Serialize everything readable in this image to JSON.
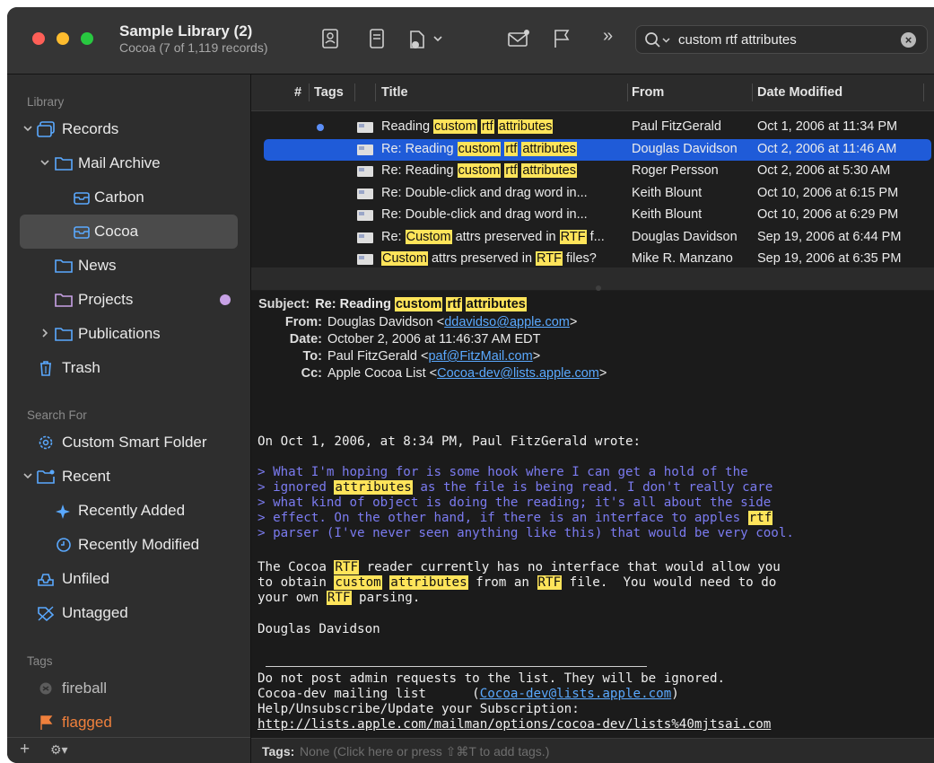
{
  "window": {
    "title": "Sample Library (2)",
    "subtitle": "Cocoa (7 of 1,119 records)"
  },
  "toolbar": {
    "icons": [
      "contact-card-icon",
      "document-icon",
      "share-icon",
      "mail-icon",
      "flag-icon",
      "overflow-icon"
    ],
    "overflow_label": "»"
  },
  "search": {
    "query": "custom rtf attributes",
    "clear_label": "×"
  },
  "sidebar": {
    "section_library": "Library",
    "section_search": "Search For",
    "section_tags": "Tags",
    "items": {
      "records": "Records",
      "mail_archive": "Mail Archive",
      "carbon": "Carbon",
      "cocoa": "Cocoa",
      "news": "News",
      "projects": "Projects",
      "publications": "Publications",
      "trash": "Trash",
      "custom_smart_folder": "Custom Smart Folder",
      "recent": "Recent",
      "recently_added": "Recently Added",
      "recently_modified": "Recently Modified",
      "unfiled": "Unfiled",
      "untagged": "Untagged",
      "fireball": "fireball",
      "flagged": "flagged"
    },
    "bottom_add": "+",
    "bottom_gear": "⚙▾"
  },
  "list": {
    "columns": [
      "#",
      "Tags",
      "Title",
      "From",
      "Date Modified"
    ],
    "rows": [
      {
        "title_parts": [
          "Reading ",
          "custom",
          " ",
          "rtf",
          " ",
          "attributes"
        ],
        "from": "Paul FitzGerald",
        "date": "Oct 1, 2006 at 11:34 PM",
        "unread": true
      },
      {
        "title_parts": [
          "Re: Reading ",
          "custom",
          " ",
          "rtf",
          " ",
          "attributes"
        ],
        "from": "Douglas Davidson",
        "date": "Oct 2, 2006 at 11:46 AM",
        "selected": true
      },
      {
        "title_parts": [
          "Re: Reading ",
          "custom",
          " ",
          "rtf",
          " ",
          "attributes"
        ],
        "from": "Roger Persson",
        "date": "Oct 2, 2006 at 5:30 AM"
      },
      {
        "title": "Re: Double-click and drag word in...",
        "from": "Keith Blount",
        "date": "Oct 10, 2006 at 6:15 PM"
      },
      {
        "title": "Re: Double-click and drag word in...",
        "from": "Keith Blount",
        "date": "Oct 10, 2006 at 6:29 PM"
      },
      {
        "title_parts": [
          "Re: ",
          "Custom",
          " attrs preserved in ",
          "RTF",
          " f..."
        ],
        "from": "Douglas Davidson",
        "date": "Sep 19, 2006 at 6:44 PM"
      },
      {
        "title_parts": [
          "Custom",
          " attrs preserved in ",
          "RTF",
          " files?"
        ],
        "from": "Mike R. Manzano",
        "date": "Sep 19, 2006 at 6:35 PM"
      }
    ]
  },
  "message": {
    "subject_key": "Subject:",
    "subject_parts": [
      "Re: Reading ",
      "custom",
      " ",
      "rtf",
      " ",
      "attributes"
    ],
    "from_key": "From:",
    "from_name": "Douglas Davidson <",
    "from_email": "ddavidso@apple.com",
    "date_key": "Date:",
    "date_value": "October 2, 2006 at 11:46:37 AM EDT",
    "to_key": "To:",
    "to_name": "Paul FitzGerald <",
    "to_email": "paf@FitzMail.com",
    "cc_key": "Cc:",
    "cc_name": "Apple Cocoa List <",
    "cc_email": "Cocoa-dev@lists.apple.com",
    "close_angle": ">",
    "attribution": "On Oct 1, 2006, at 8:34 PM, Paul FitzGerald wrote:",
    "quote_lines": [
      "> What I'm hoping for is some hook where I can get a hold of the",
      "> ignored ",
      "attributes",
      " as the file is being read. I don't really care",
      "> what kind of object is doing the reading; it's all about the side",
      "> effect. On the other hand, if there is an interface to apples ",
      "rtf",
      "> parser (I've never seen anything like this) that would be very cool."
    ],
    "body_lines": [
      "The Cocoa ",
      "RTF",
      " reader currently has no interface that would allow you",
      "to obtain ",
      "custom",
      " ",
      "attributes",
      " from an ",
      "RTF",
      " file.  You would need to do",
      "your own ",
      "RTF",
      " parsing."
    ],
    "signature": "Douglas Davidson",
    "footer_lines": [
      "Do not post admin requests to the list. They will be ignored.",
      "Cocoa-dev mailing list      (",
      "Cocoa-dev@lists.apple.com",
      ")",
      "Help/Unsubscribe/Update your Subscription:",
      "http://lists.apple.com/mailman/options/cocoa-dev/lists%40mjtsai.com"
    ]
  },
  "tags_bar": {
    "label": "Tags:",
    "value": "None (Click here or press ⇧⌘T to add tags.)"
  },
  "colors": {
    "highlight": "#ffe45a",
    "selection": "#1f5bd8",
    "link": "#5aa9ff",
    "quote": "#7b7bf0",
    "flagged": "#f0803c"
  }
}
